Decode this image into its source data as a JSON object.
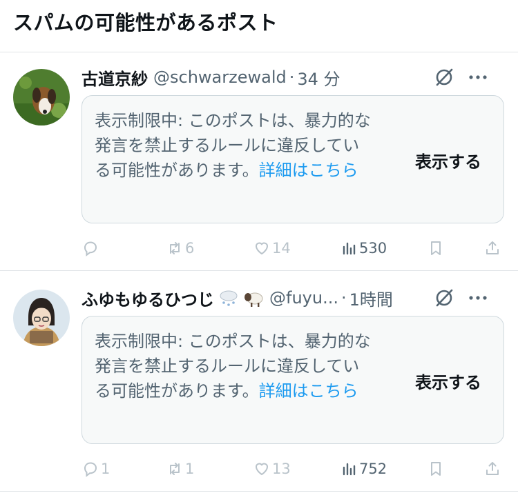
{
  "header": {
    "title": "スパムの可能性があるポスト"
  },
  "posts": [
    {
      "author": "古道京紗",
      "handle": "@schwarzewald",
      "separator": "·",
      "time": "34 分",
      "notice": {
        "text": "表示制限中: このポストは、暴力的な発言を禁止するルールに違反している可能性があります。",
        "link": "詳細はこちら",
        "button": "表示する"
      },
      "metrics": {
        "replies": "",
        "reposts": "6",
        "likes": "14",
        "views": "530"
      }
    },
    {
      "author": "ふゆもゆるひつじ",
      "handle": "@fuyu...",
      "separator": "·",
      "time": "1時間",
      "emojis": [
        "cloud-snow-icon",
        "sheep-icon"
      ],
      "notice": {
        "text": "表示制限中: このポストは、暴力的な発言を禁止するルールに違反している可能性があります。",
        "link": "詳細はこちら",
        "button": "表示する"
      },
      "metrics": {
        "replies": "1",
        "reposts": "1",
        "likes": "13",
        "views": "752"
      }
    }
  ],
  "colors": {
    "link": "#1d9bf0",
    "muted": "#536471",
    "border": "#cfd9de",
    "card_bg": "#f7f9f9"
  }
}
